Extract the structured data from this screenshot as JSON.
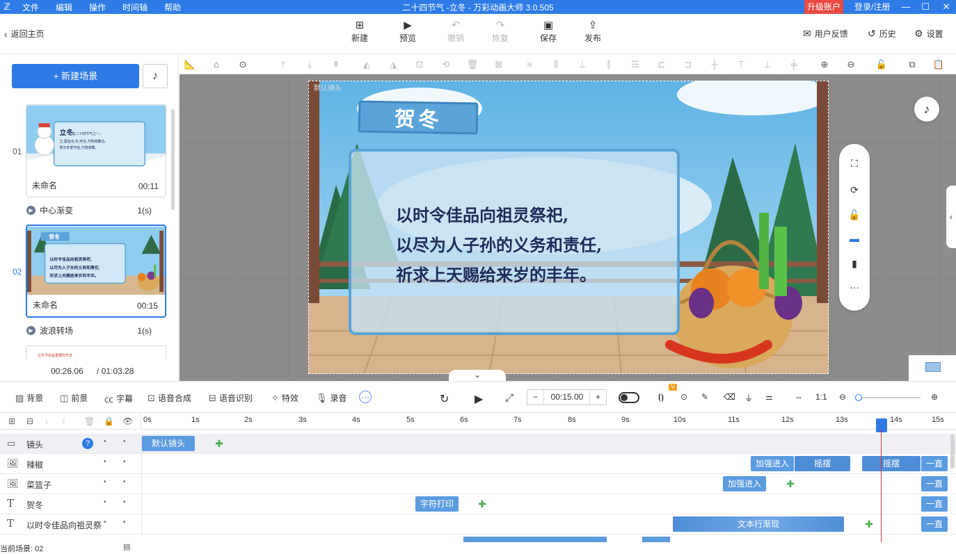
{
  "titlebar": {
    "logo": "ℤ",
    "menu": [
      "文件",
      "编辑",
      "操作",
      "时间轴",
      "帮助"
    ],
    "title": "二十四节气 -立冬 - 万彩动画大师 3.0.505",
    "upgrade": "升级账户",
    "login": "登录/注册",
    "min": "—",
    "max": "☐",
    "close": "✕"
  },
  "toolbar": {
    "new": "新建",
    "preview": "预览",
    "undo": "撤销",
    "redo": "恢复",
    "save": "保存",
    "publish": "发布",
    "back": "返回主页",
    "feedback": "用户反馈",
    "history": "历史",
    "settings": "设置"
  },
  "left": {
    "new_scene": "+ 新建场景",
    "music_icon": "♪",
    "scenes": [
      {
        "index": "01",
        "name": "未命名",
        "duration": "00:11",
        "transition": "中心渐变",
        "trans_time": "1(s)"
      },
      {
        "index": "02",
        "name": "未命名",
        "duration": "00:15",
        "transition": "波浪转场",
        "trans_time": "1(s)"
      }
    ],
    "scene1_text": [
      "立冬",
      "是二十四节气之一。",
      "立,建始也;冬,终也,万物收藏也。",
      "表示冬季开始,万物收藏。"
    ],
    "scene2_text": [
      "贺冬",
      "以时令佳品向祖灵祭祀,",
      "以尽为人子孙的义务和责任,",
      "祈求上天赐给来岁的丰年。"
    ],
    "scene3_text": "立冬节日是重要的节日",
    "time_current": "00:26.06",
    "time_total": "/ 01:03.28"
  },
  "stage": {
    "badge": "贺冬",
    "lines": [
      "以时令佳品向祖灵祭祀,",
      "以尽为人子孙的义务和责任,",
      "祈求上天赐给来岁的丰年。"
    ],
    "camera_label": "默认镜头"
  },
  "ctrl": {
    "bg": "背景",
    "fg": "前景",
    "subtitle": "字幕",
    "tts": "语音合成",
    "asr": "语音识别",
    "fx": "特效",
    "record": "录音",
    "time": "00:15.00",
    "minus": "−",
    "plus": "+"
  },
  "timeline": {
    "ticks": [
      "0s",
      "1s",
      "2s",
      "3s",
      "4s",
      "5s",
      "6s",
      "7s",
      "8s",
      "9s",
      "10s",
      "11s",
      "12s",
      "13s",
      "14s",
      "15s"
    ],
    "rows": [
      {
        "name": "镜头"
      },
      {
        "name": "辣椒"
      },
      {
        "name": "菜篮子"
      },
      {
        "name": "贺冬"
      },
      {
        "name": "以时令佳品向祖灵祭"
      }
    ],
    "clips": {
      "cam": "默认镜头",
      "enter": "加强进入",
      "shake": "摇摆",
      "always": "一直",
      "type": "字符打印",
      "textline": "文本行渐现"
    }
  },
  "status": {
    "current_scene": "当前场景: 02"
  },
  "colors": {
    "accent": "#2d7ae5",
    "titlebar": "#2e7be6",
    "upgrade": "#ea4a42"
  }
}
